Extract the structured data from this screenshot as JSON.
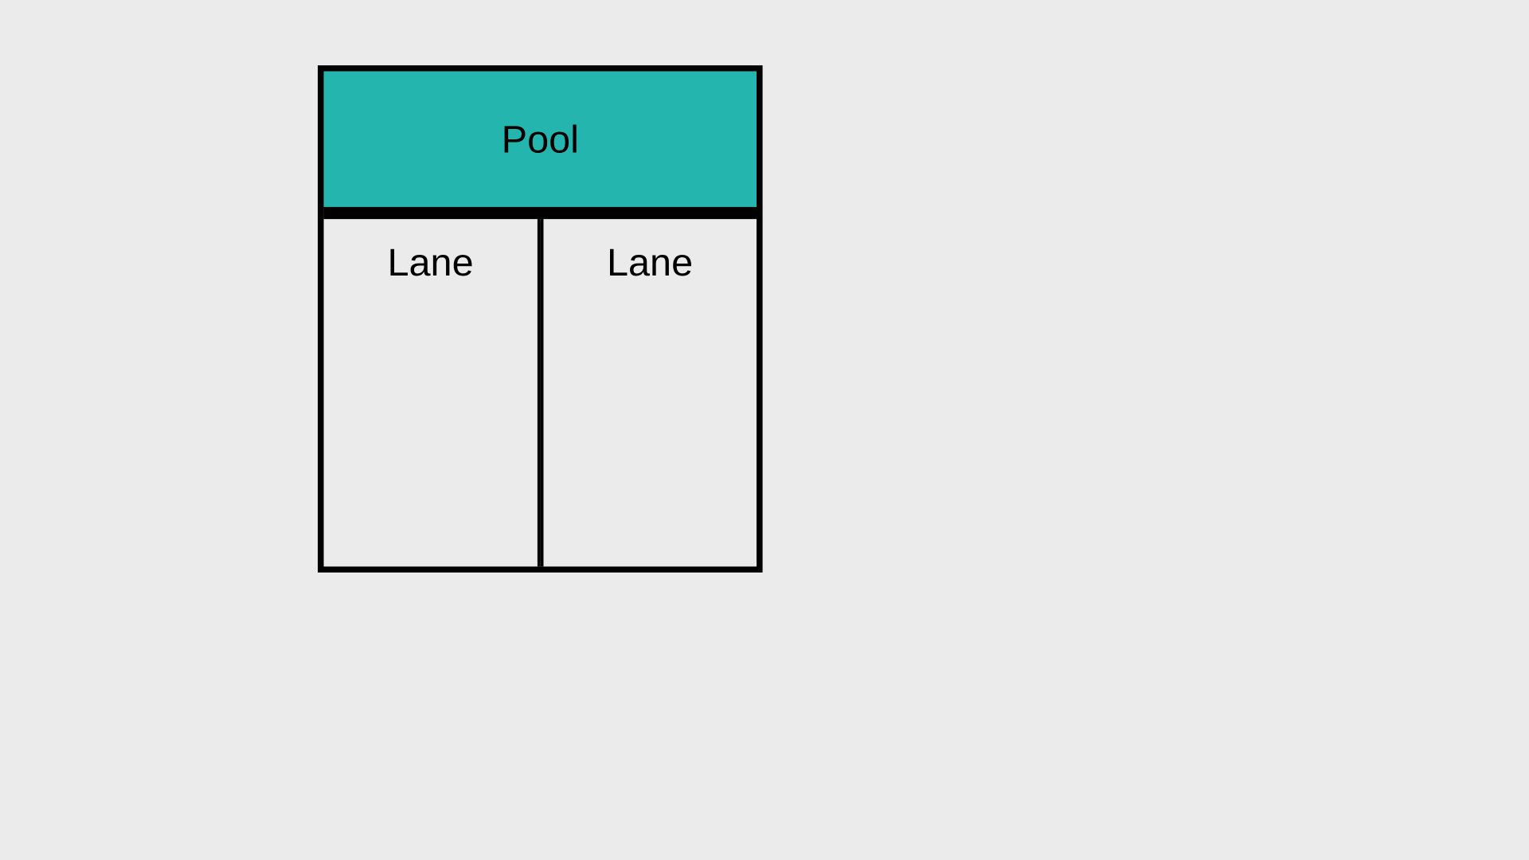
{
  "pool": {
    "header_label": "Pool",
    "lanes": [
      {
        "label": "Lane"
      },
      {
        "label": "Lane"
      }
    ]
  },
  "colors": {
    "pool_header_bg": "#24b6ae",
    "canvas_bg": "#ebebeb",
    "border": "#000000"
  }
}
